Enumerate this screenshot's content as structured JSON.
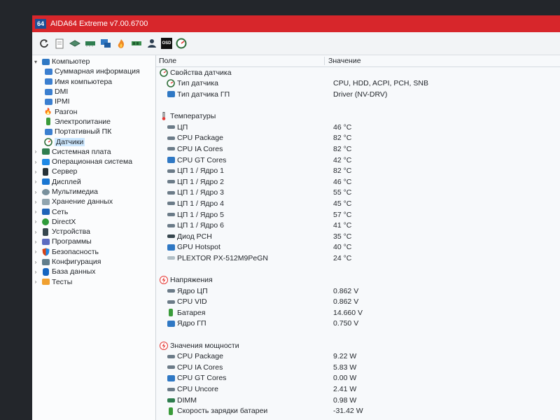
{
  "window": {
    "title": "AIDA64 Extreme v7.00.6700",
    "app_icon_text": "64"
  },
  "toolbar": {
    "buttons": [
      "refresh-icon",
      "report-icon",
      "motherboard-icon",
      "memory-icon",
      "network-icon",
      "flame-icon",
      "ram-icon",
      "user-icon",
      "osd-icon",
      "sensor-icon"
    ],
    "osd_label": "OSD"
  },
  "tree": {
    "root": "Компьютер",
    "children": [
      "Суммарная информация",
      "Имя компьютера",
      "DMI",
      "IPMI",
      "Разгон",
      "Электропитание",
      "Портативный ПК",
      "Датчики"
    ],
    "top_items": [
      "Системная плата",
      "Операционная система",
      "Сервер",
      "Дисплей",
      "Мультимедиа",
      "Хранение данных",
      "Сеть",
      "DirectX",
      "Устройства",
      "Программы",
      "Безопасность",
      "Конфигурация",
      "База данных",
      "Тесты"
    ]
  },
  "list": {
    "headers": {
      "field": "Поле",
      "value": "Значение"
    },
    "groups": [
      {
        "title": "Свойства датчика",
        "items": [
          {
            "name": "Тип датчика",
            "value": "CPU, HDD, ACPI, PCH, SNB"
          },
          {
            "name": "Тип датчика ГП",
            "value": "Driver  (NV-DRV)"
          }
        ]
      },
      {
        "title": "Температуры",
        "items": [
          {
            "name": "ЦП",
            "value": "46 °C"
          },
          {
            "name": "CPU Package",
            "value": "82 °C"
          },
          {
            "name": "CPU IA Cores",
            "value": "82 °C"
          },
          {
            "name": "CPU GT Cores",
            "value": "42 °C"
          },
          {
            "name": "ЦП 1 / Ядро 1",
            "value": "82 °C"
          },
          {
            "name": "ЦП 1 / Ядро 2",
            "value": "46 °C"
          },
          {
            "name": "ЦП 1 / Ядро 3",
            "value": "55 °C"
          },
          {
            "name": "ЦП 1 / Ядро 4",
            "value": "45 °C"
          },
          {
            "name": "ЦП 1 / Ядро 5",
            "value": "57 °C"
          },
          {
            "name": "ЦП 1 / Ядро 6",
            "value": "41 °C"
          },
          {
            "name": "Диод PCH",
            "value": "35 °C"
          },
          {
            "name": "GPU Hotspot",
            "value": "40 °C"
          },
          {
            "name": "PLEXTOR PX-512M9PeGN",
            "value": "24 °C"
          }
        ]
      },
      {
        "title": "Напряжения",
        "items": [
          {
            "name": "Ядро ЦП",
            "value": "0.862 V"
          },
          {
            "name": "CPU VID",
            "value": "0.862 V"
          },
          {
            "name": "Батарея",
            "value": "14.660 V"
          },
          {
            "name": "Ядро ГП",
            "value": "0.750 V"
          }
        ]
      },
      {
        "title": "Значения мощности",
        "items": [
          {
            "name": "CPU Package",
            "value": "9.22 W"
          },
          {
            "name": "CPU IA Cores",
            "value": "5.83 W"
          },
          {
            "name": "CPU GT Cores",
            "value": "0.00 W"
          },
          {
            "name": "CPU Uncore",
            "value": "2.41 W"
          },
          {
            "name": "DIMM",
            "value": "0.98 W"
          },
          {
            "name": "Скорость зарядки батареи",
            "value": "-31.42 W"
          }
        ]
      }
    ]
  },
  "colors": {
    "titlebar": "#d7262b",
    "selection": "#cde8ff",
    "text": "#1f2328"
  }
}
